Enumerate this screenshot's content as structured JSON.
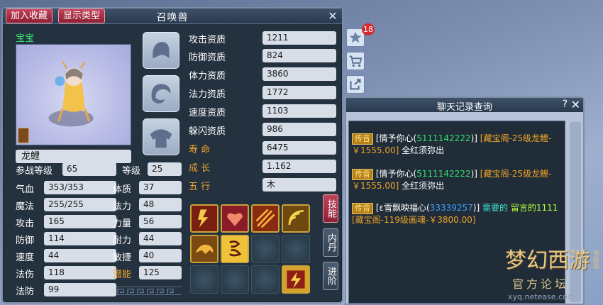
{
  "window": {
    "title": "召唤兽",
    "close_label": "✕",
    "fav_button": "加入收藏",
    "type_button": "显示类型"
  },
  "pet": {
    "baobao_label": "宝宝",
    "name": "龙鲤"
  },
  "aptitudes": [
    {
      "label": "攻击资质",
      "value": "1211"
    },
    {
      "label": "防御资质",
      "value": "824"
    },
    {
      "label": "体力资质",
      "value": "3860"
    },
    {
      "label": "法力资质",
      "value": "1772"
    },
    {
      "label": "速度资质",
      "value": "1103"
    },
    {
      "label": "躲闪资质",
      "value": "986"
    }
  ],
  "extra": [
    {
      "label": "寿    命",
      "value": "6475"
    },
    {
      "label": "成    长",
      "value": "1.162"
    },
    {
      "label": "五    行",
      "value": "木"
    }
  ],
  "level_row": {
    "battle_level_label": "参战等级",
    "battle_level": "65",
    "level_label": "等级",
    "level": "25"
  },
  "stats_left": [
    {
      "label": "气血",
      "value": "353/353"
    },
    {
      "label": "魔法",
      "value": "255/255"
    },
    {
      "label": "攻击",
      "value": "165"
    },
    {
      "label": "防御",
      "value": "114"
    },
    {
      "label": "速度",
      "value": "44"
    },
    {
      "label": "法伤",
      "value": "118"
    },
    {
      "label": "法防",
      "value": "99"
    }
  ],
  "stats_right": [
    {
      "label": "体质",
      "value": "37"
    },
    {
      "label": "法力",
      "value": "48"
    },
    {
      "label": "力量",
      "value": "56"
    },
    {
      "label": "耐力",
      "value": "44"
    },
    {
      "label": "敏捷",
      "value": "40"
    },
    {
      "label": "潜能",
      "value": "125"
    }
  ],
  "side_tabs": {
    "skills": "技能",
    "neidan": "内丹",
    "advance": "进阶"
  },
  "icons": {
    "favorites_badge": "18"
  },
  "chat": {
    "title": "聊天记录查询",
    "help": "?",
    "close": "✕",
    "messages": [
      {
        "tag": "传音",
        "prefix": "[情予你心(",
        "colorful_id": "5111142222",
        "suffix": ")]",
        "link": "[藏宝阁-25级龙鲤-￥1555.00]",
        "text": "全红须弥出"
      },
      {
        "tag": "传音",
        "prefix": "[情予你心(",
        "colorful_id": "5111142222",
        "suffix": ")]",
        "link": "[藏宝阁-25级龙鲤-￥1555.00]",
        "text": "全红须弥出"
      },
      {
        "tag": "传音",
        "prefix": "[ε雪飘映福心(",
        "colorful_id": "33339257",
        "suffix": ")]",
        "text_a": "需要的",
        "text_b": "留言的1111",
        "link": "[藏宝阁-119级画魂-￥3800.00]"
      }
    ]
  },
  "watermark": {
    "title": "梦幻西游",
    "subtitle": "官方论坛",
    "url": "xyq.netease.com",
    "edition": "电脑版"
  }
}
